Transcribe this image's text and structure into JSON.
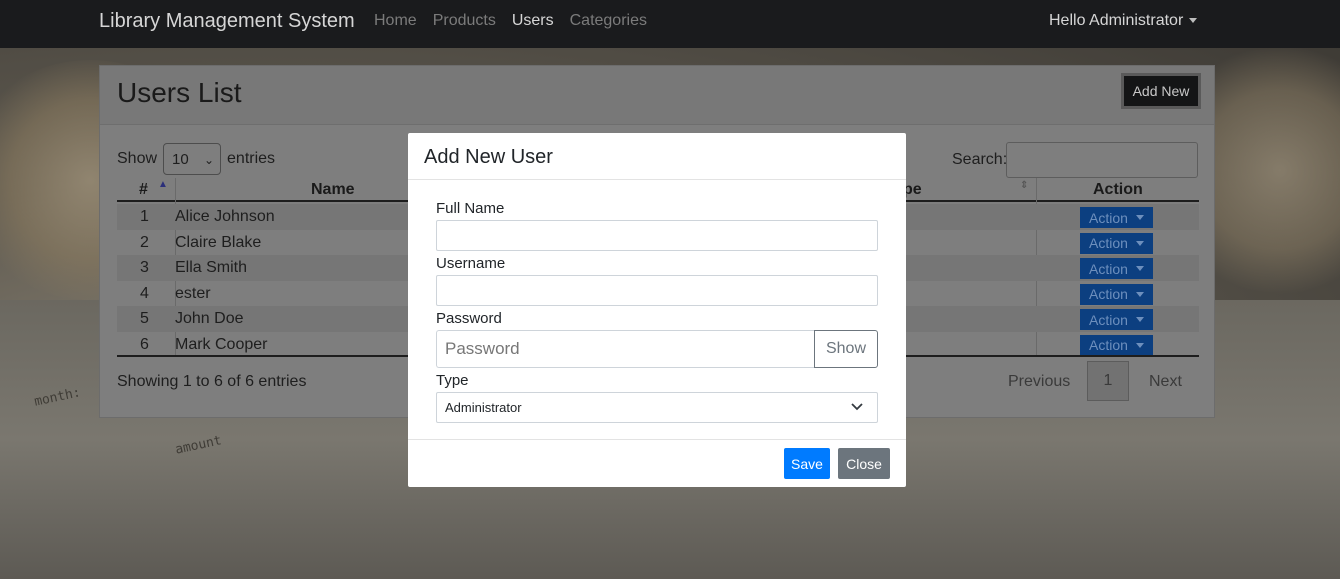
{
  "navbar": {
    "brand": "Library Management System",
    "links": [
      "Home",
      "Products",
      "Users",
      "Categories"
    ],
    "active_link": "Users",
    "user_menu": "Hello Administrator"
  },
  "background": {
    "text_month": "month:",
    "text_amount": "amount"
  },
  "card": {
    "title": "Users List",
    "add_new_label": "Add New",
    "show_label": "Show",
    "entries_label": "entries",
    "page_length": "10",
    "search_label": "Search:",
    "search_value": "",
    "columns": [
      "#",
      "Name",
      "pe",
      "Action"
    ],
    "rows": [
      {
        "num": "1",
        "name": "Alice Johnson",
        "action": "Action"
      },
      {
        "num": "2",
        "name": "Claire Blake",
        "action": "Action"
      },
      {
        "num": "3",
        "name": "Ella Smith",
        "action": "Action"
      },
      {
        "num": "4",
        "name": "ester",
        "action": "Action"
      },
      {
        "num": "5",
        "name": "John Doe",
        "action": "Action"
      },
      {
        "num": "6",
        "name": "Mark Cooper",
        "action": "Action"
      }
    ],
    "info": "Showing 1 to 6 of 6 entries",
    "pagination": {
      "previous": "Previous",
      "current": "1",
      "next": "Next"
    }
  },
  "modal": {
    "title": "Add New User",
    "full_name_label": "Full Name",
    "full_name_value": "",
    "username_label": "Username",
    "username_value": "",
    "password_label": "Password",
    "password_placeholder": "Password",
    "show_label": "Show",
    "type_label": "Type",
    "type_value": "Administrator",
    "save_label": "Save",
    "close_label": "Close"
  },
  "colors": {
    "navbar_bg": "#1a1b1d",
    "primary": "#007bff",
    "secondary": "#6c757d",
    "action_dimmed": "#0c3f80"
  }
}
